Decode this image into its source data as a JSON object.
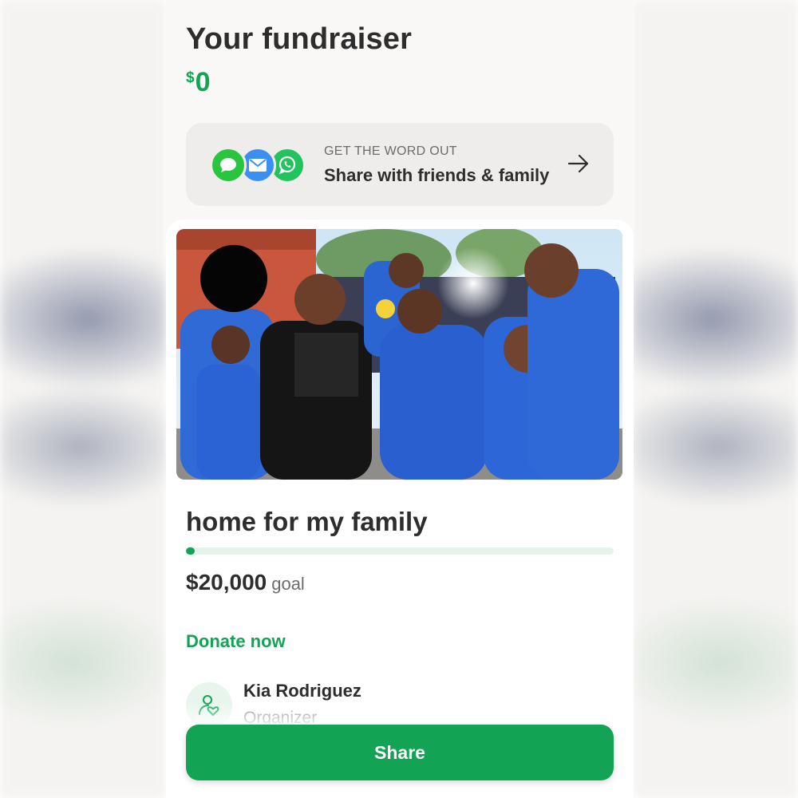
{
  "header": {
    "title": "Your fundraiser",
    "raised_currency": "$",
    "raised_amount": "0"
  },
  "share_card": {
    "kicker": "GET THE WORD OUT",
    "text": "Share with friends & family",
    "icons": [
      "messages-icon",
      "mail-icon",
      "whatsapp-icon"
    ]
  },
  "campaign": {
    "photo_description": "Family group photo at a graduation",
    "title": "home for my family",
    "progress_fraction": 0,
    "goal_amount": "$20,000",
    "goal_word": "goal",
    "donate_label": "Donate now"
  },
  "organizer": {
    "name": "Kia Rodriguez",
    "role": "Organizer"
  },
  "footer": {
    "share_label": "Share"
  },
  "colors": {
    "brand_green": "#12a454",
    "text_dark": "#2d2d2d",
    "card_bg": "#efedeb"
  }
}
